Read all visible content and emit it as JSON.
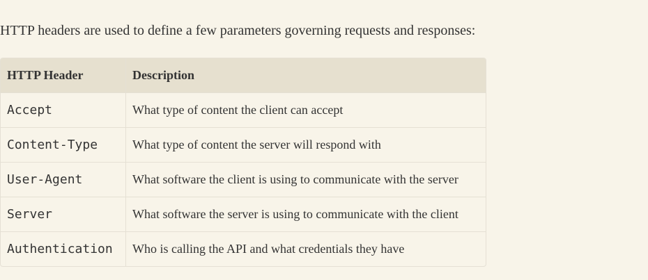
{
  "intro": "HTTP headers are used to define a few parameters governing requests and responses:",
  "table": {
    "headers": [
      "HTTP Header",
      "Description"
    ],
    "rows": [
      {
        "name": "Accept",
        "description": "What type of content the client can accept"
      },
      {
        "name": "Content-Type",
        "description": "What type of content the server will respond with"
      },
      {
        "name": "User-Agent",
        "description": "What software the client is using to communicate with the server"
      },
      {
        "name": "Server",
        "description": "What software the server is using to communicate with the client"
      },
      {
        "name": "Authentication",
        "description": "Who is calling the API and what credentials they have"
      }
    ]
  }
}
